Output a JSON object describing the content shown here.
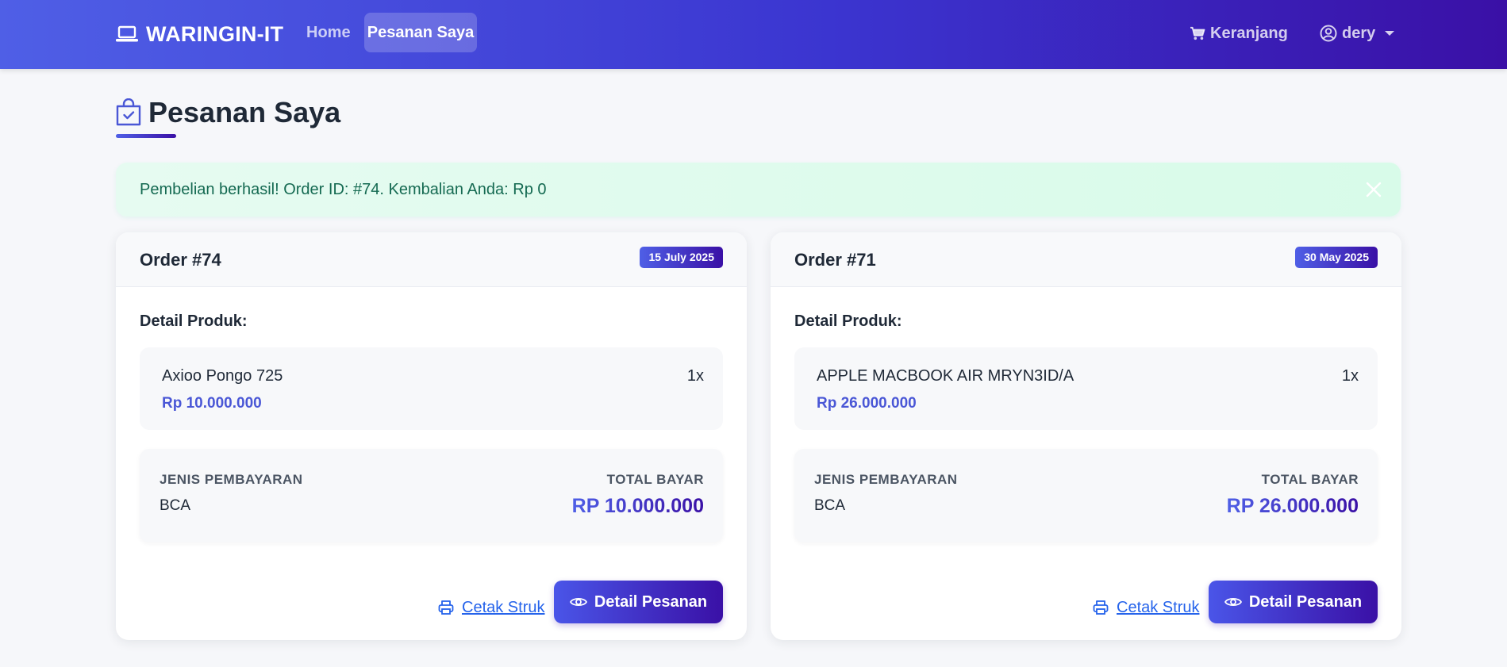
{
  "navbar": {
    "brand": "WARINGIN-IT",
    "links": [
      {
        "label": "Home",
        "active": false
      },
      {
        "label": "Pesanan Saya",
        "active": true
      }
    ],
    "cart_label": "Keranjang",
    "user_label": "dery"
  },
  "page": {
    "title": "Pesanan Saya"
  },
  "alert": {
    "message": "Pembelian berhasil! Order ID: #74. Kembalian Anda: Rp 0"
  },
  "orders": [
    {
      "title": "Order #74",
      "date": "15 July 2025",
      "detail_label": "Detail Produk:",
      "product": {
        "name": "Axioo Pongo 725",
        "qty": "1x",
        "price": "Rp 10.000.000"
      },
      "payment_label": "JENIS PEMBAYARAN",
      "payment_value": "BCA",
      "total_label": "TOTAL BAYAR",
      "total_value": "RP 10.000.000",
      "print_label": "Cetak Struk",
      "detail_button": "Detail Pesanan"
    },
    {
      "title": "Order #71",
      "date": "30 May 2025",
      "detail_label": "Detail Produk:",
      "product": {
        "name": "APPLE MACBOOK AIR MRYN3ID/A",
        "qty": "1x",
        "price": "Rp 26.000.000"
      },
      "payment_label": "JENIS PEMBAYARAN",
      "payment_value": "BCA",
      "total_label": "TOTAL BAYAR",
      "total_value": "RP 26.000.000",
      "print_label": "Cetak Struk",
      "detail_button": "Detail Pesanan"
    }
  ],
  "colors": {
    "nav_gradient_start": "#4f5fe6",
    "nav_gradient_end": "#3a10a6",
    "alert_bg": "#dffbee",
    "alert_text": "#156a52",
    "price_text": "#4a57d6",
    "link_blue": "#2563eb"
  },
  "icons": {
    "brand": "laptop-icon",
    "cart": "cart-icon",
    "user": "user-circle-icon",
    "title": "shopping-bag-check-icon",
    "close": "close-icon",
    "print": "printer-icon",
    "view": "eye-icon"
  }
}
